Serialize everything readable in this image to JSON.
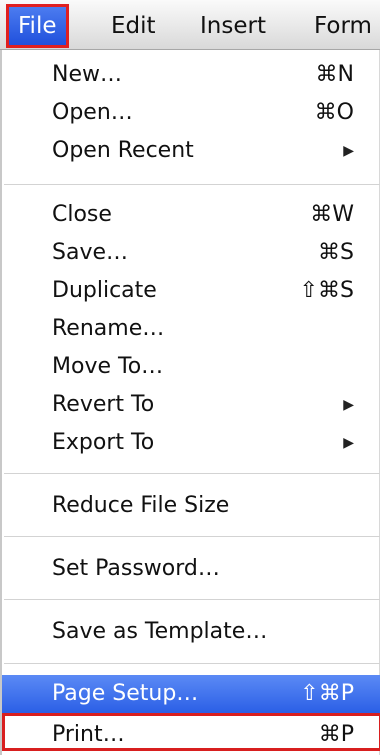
{
  "menubar": {
    "items": [
      "File",
      "Edit",
      "Insert",
      "Form"
    ]
  },
  "menu": {
    "new": {
      "label": "New…",
      "shortcut": "⌘N"
    },
    "open": {
      "label": "Open…",
      "shortcut": "⌘O"
    },
    "open_recent": {
      "label": "Open Recent",
      "submenu_glyph": "▶"
    },
    "close": {
      "label": "Close",
      "shortcut": "⌘W"
    },
    "save": {
      "label": "Save…",
      "shortcut": "⌘S"
    },
    "duplicate": {
      "label": "Duplicate",
      "shortcut": "⇧⌘S"
    },
    "rename": {
      "label": "Rename…"
    },
    "move_to": {
      "label": "Move To…"
    },
    "revert_to": {
      "label": "Revert To",
      "submenu_glyph": "▶"
    },
    "export_to": {
      "label": "Export To",
      "submenu_glyph": "▶"
    },
    "reduce_file_size": {
      "label": "Reduce File Size"
    },
    "set_password": {
      "label": "Set Password…"
    },
    "save_as_template": {
      "label": "Save as Template…"
    },
    "page_setup": {
      "label": "Page Setup…",
      "shortcut": "⇧⌘P"
    },
    "print": {
      "label": "Print…",
      "shortcut": "⌘P"
    }
  },
  "colors": {
    "highlight": "#2b5fe6",
    "callout_box": "#d81f1f"
  }
}
